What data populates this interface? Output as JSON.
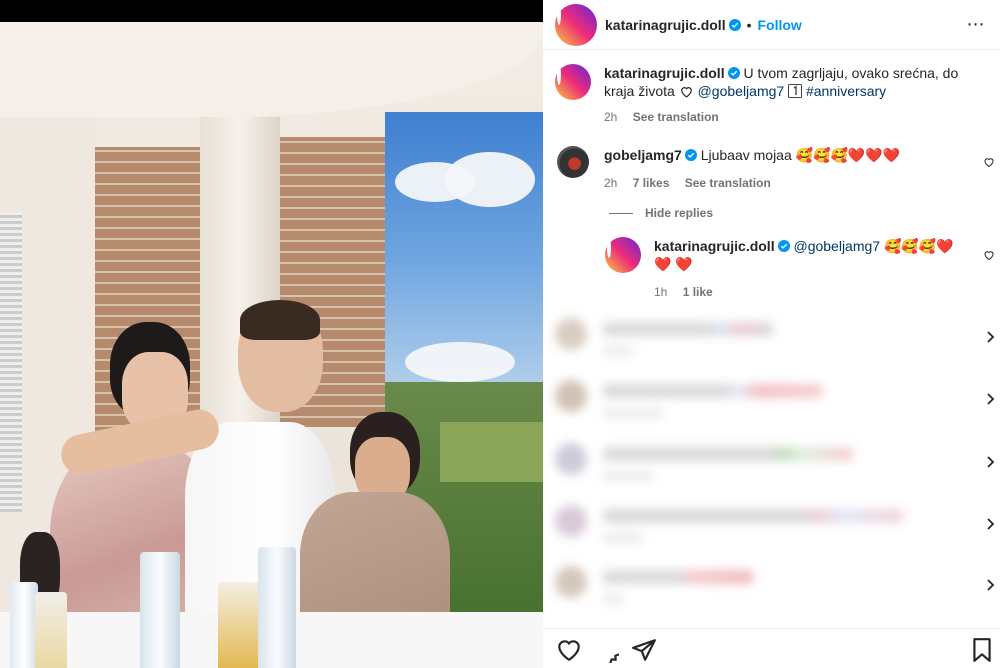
{
  "post": {
    "author": "katarinagrujic.doll",
    "separator": "•",
    "follow_label": "Follow",
    "more_label": "⋯"
  },
  "caption": {
    "username": "katarinagrujic.doll",
    "text": "U tvom zagrljaju, ovako srećna, do kraja života",
    "mention": "@gobeljamg7",
    "hashtag": "#anniversary",
    "time": "2h",
    "see_translation": "See translation"
  },
  "comment": {
    "username": "gobeljamg7",
    "text": "Ljubaav mojaa",
    "emojis": "🥰🥰🥰❤️❤️❤️",
    "time": "2h",
    "likes": "7 likes",
    "see_translation": "See translation"
  },
  "hide_replies_label": "Hide replies",
  "reply": {
    "username": "katarinagrujic.doll",
    "mention": "@gobeljamg7",
    "emojis": "🥰🥰🥰❤️❤️",
    "emojis_line2": "❤️",
    "time": "1h",
    "likes": "1 like"
  },
  "icons": {
    "like": "heart-icon",
    "comment": "comment-icon",
    "share": "share-icon",
    "save": "bookmark-icon",
    "verified": "verified-badge-icon",
    "more": "more-options-icon"
  },
  "colors": {
    "link": "#00376b",
    "follow": "#0095f6",
    "verified": "#0095f6",
    "muted": "#737373",
    "heart_red": "#e0162b"
  }
}
